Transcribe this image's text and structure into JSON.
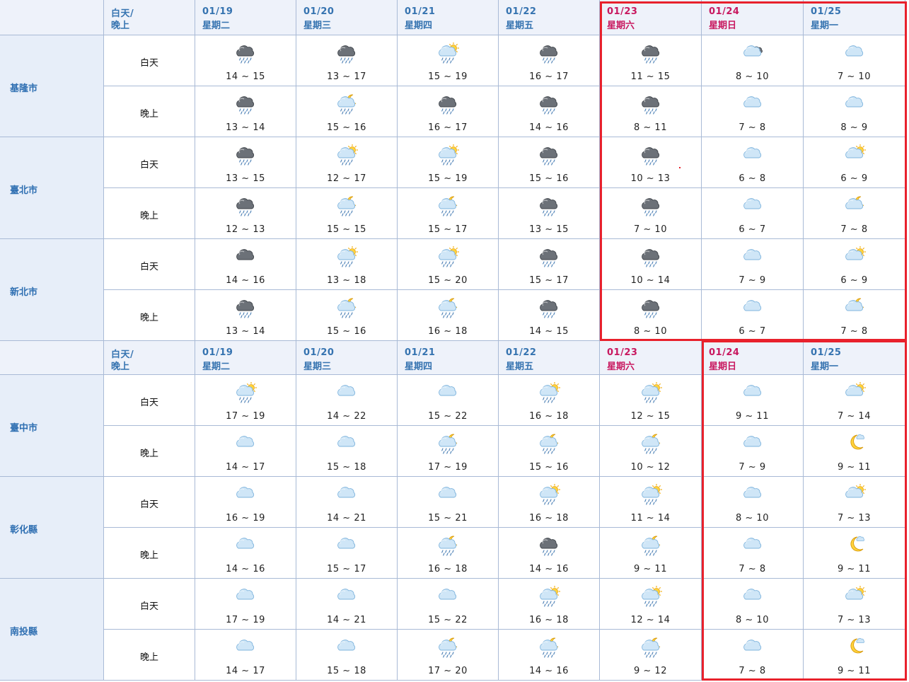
{
  "period_header": {
    "line1": "白天/",
    "line2": "晚上"
  },
  "days": [
    {
      "date": "01/19",
      "weekday": "星期二",
      "weekend": false
    },
    {
      "date": "01/20",
      "weekday": "星期三",
      "weekend": false
    },
    {
      "date": "01/21",
      "weekday": "星期四",
      "weekend": false
    },
    {
      "date": "01/22",
      "weekday": "星期五",
      "weekend": false
    },
    {
      "date": "01/23",
      "weekday": "星期六",
      "weekend": true
    },
    {
      "date": "01/24",
      "weekday": "星期日",
      "weekend": true
    },
    {
      "date": "01/25",
      "weekday": "星期一",
      "weekend": false
    }
  ],
  "period_labels": {
    "day": "白天",
    "night": "晚上"
  },
  "highlight_color": "#e8212c",
  "sections": [
    {
      "cities": [
        {
          "name": "基隆市",
          "day": [
            {
              "icon": "dark-cloud-rain-icon",
              "temp": "14 ~ 15"
            },
            {
              "icon": "dark-cloud-rain-icon",
              "temp": "13 ~ 17"
            },
            {
              "icon": "sun-cloud-rain-icon",
              "temp": "15 ~ 19"
            },
            {
              "icon": "dark-cloud-rain-icon",
              "temp": "16 ~ 17"
            },
            {
              "icon": "dark-cloud-rain-icon",
              "temp": "11 ~ 15"
            },
            {
              "icon": "cloud-dark-icon",
              "temp": "8 ~ 10"
            },
            {
              "icon": "cloud-icon",
              "temp": "7 ~ 10"
            }
          ],
          "night": [
            {
              "icon": "dark-cloud-rain-icon",
              "temp": "13 ~ 14"
            },
            {
              "icon": "moon-cloud-rain-icon",
              "temp": "15 ~ 16"
            },
            {
              "icon": "dark-cloud-rain-icon",
              "temp": "16 ~ 17"
            },
            {
              "icon": "dark-cloud-rain-icon",
              "temp": "14 ~ 16"
            },
            {
              "icon": "dark-cloud-rain-icon",
              "temp": "8 ~ 11"
            },
            {
              "icon": "cloud-icon",
              "temp": "7 ~ 8"
            },
            {
              "icon": "cloud-icon",
              "temp": "8 ~ 9"
            }
          ]
        },
        {
          "name": "臺北市",
          "day": [
            {
              "icon": "dark-cloud-rain-icon",
              "temp": "13 ~ 15"
            },
            {
              "icon": "sun-cloud-rain-icon",
              "temp": "12 ~ 17"
            },
            {
              "icon": "sun-cloud-rain-icon",
              "temp": "15 ~ 19"
            },
            {
              "icon": "dark-cloud-rain-icon",
              "temp": "15 ~ 16"
            },
            {
              "icon": "dark-cloud-rain-icon",
              "temp": "10 ~ 13"
            },
            {
              "icon": "cloud-icon",
              "temp": "6 ~ 8"
            },
            {
              "icon": "sun-cloud-icon",
              "temp": "6 ~ 9"
            }
          ],
          "night": [
            {
              "icon": "dark-cloud-rain-icon",
              "temp": "12 ~ 13"
            },
            {
              "icon": "moon-cloud-rain-icon",
              "temp": "15 ~ 15"
            },
            {
              "icon": "moon-cloud-rain-icon",
              "temp": "15 ~ 17"
            },
            {
              "icon": "dark-cloud-rain-icon",
              "temp": "13 ~ 15"
            },
            {
              "icon": "dark-cloud-rain-icon",
              "temp": "7 ~ 10"
            },
            {
              "icon": "cloud-icon",
              "temp": "6 ~ 7"
            },
            {
              "icon": "moon-cloud-icon",
              "temp": "7 ~ 8"
            }
          ]
        },
        {
          "name": "新北市",
          "day": [
            {
              "icon": "dark-cloud-icon",
              "temp": "14 ~ 16"
            },
            {
              "icon": "sun-cloud-rain-icon",
              "temp": "13 ~ 18"
            },
            {
              "icon": "sun-cloud-rain-icon",
              "temp": "15 ~ 20"
            },
            {
              "icon": "dark-cloud-rain-icon",
              "temp": "15 ~ 17"
            },
            {
              "icon": "dark-cloud-rain-icon",
              "temp": "10 ~ 14"
            },
            {
              "icon": "cloud-icon",
              "temp": "7 ~ 9"
            },
            {
              "icon": "sun-cloud-icon",
              "temp": "6 ~ 9"
            }
          ],
          "night": [
            {
              "icon": "dark-cloud-rain-icon",
              "temp": "13 ~ 14"
            },
            {
              "icon": "moon-cloud-rain-icon",
              "temp": "15 ~ 16"
            },
            {
              "icon": "moon-cloud-rain-icon",
              "temp": "16 ~ 18"
            },
            {
              "icon": "dark-cloud-rain-icon",
              "temp": "14 ~ 15"
            },
            {
              "icon": "dark-cloud-rain-icon",
              "temp": "8 ~ 10"
            },
            {
              "icon": "cloud-icon",
              "temp": "6 ~ 7"
            },
            {
              "icon": "moon-cloud-icon",
              "temp": "7 ~ 8"
            }
          ]
        }
      ]
    },
    {
      "cities": [
        {
          "name": "臺中市",
          "day": [
            {
              "icon": "sun-cloud-rain-icon",
              "temp": "17 ~ 19"
            },
            {
              "icon": "cloud-icon",
              "temp": "14 ~ 22"
            },
            {
              "icon": "cloud-icon",
              "temp": "15 ~ 22"
            },
            {
              "icon": "sun-cloud-rain-icon",
              "temp": "16 ~ 18"
            },
            {
              "icon": "sun-cloud-rain-icon",
              "temp": "12 ~ 15"
            },
            {
              "icon": "cloud-icon",
              "temp": "9 ~ 11"
            },
            {
              "icon": "sun-cloud-icon",
              "temp": "7 ~ 14"
            }
          ],
          "night": [
            {
              "icon": "cloud-icon",
              "temp": "14 ~ 17"
            },
            {
              "icon": "cloud-icon",
              "temp": "15 ~ 18"
            },
            {
              "icon": "moon-cloud-rain-icon",
              "temp": "17 ~ 19"
            },
            {
              "icon": "moon-cloud-rain-icon",
              "temp": "15 ~ 16"
            },
            {
              "icon": "moon-cloud-rain-icon",
              "temp": "10 ~ 12"
            },
            {
              "icon": "cloud-icon",
              "temp": "7 ~ 9"
            },
            {
              "icon": "moon-icon",
              "temp": "9 ~ 11"
            }
          ]
        },
        {
          "name": "彰化縣",
          "day": [
            {
              "icon": "cloud-icon",
              "temp": "16 ~ 19"
            },
            {
              "icon": "cloud-icon",
              "temp": "14 ~ 21"
            },
            {
              "icon": "cloud-icon",
              "temp": "15 ~ 21"
            },
            {
              "icon": "sun-cloud-rain-icon",
              "temp": "16 ~ 18"
            },
            {
              "icon": "sun-cloud-rain-icon",
              "temp": "11 ~ 14"
            },
            {
              "icon": "cloud-icon",
              "temp": "8 ~ 10"
            },
            {
              "icon": "sun-cloud-icon",
              "temp": "7 ~ 13"
            }
          ],
          "night": [
            {
              "icon": "cloud-icon",
              "temp": "14 ~ 16"
            },
            {
              "icon": "cloud-icon",
              "temp": "15 ~ 17"
            },
            {
              "icon": "moon-cloud-rain-icon",
              "temp": "16 ~ 18"
            },
            {
              "icon": "dark-cloud-rain-icon",
              "temp": "14 ~ 16"
            },
            {
              "icon": "moon-cloud-rain-icon",
              "temp": "9 ~ 11"
            },
            {
              "icon": "cloud-icon",
              "temp": "7 ~ 8"
            },
            {
              "icon": "moon-icon",
              "temp": "9 ~ 11"
            }
          ]
        },
        {
          "name": "南投縣",
          "day": [
            {
              "icon": "cloud-icon",
              "temp": "17 ~ 19"
            },
            {
              "icon": "cloud-icon",
              "temp": "14 ~ 21"
            },
            {
              "icon": "cloud-icon",
              "temp": "15 ~ 22"
            },
            {
              "icon": "sun-cloud-rain-icon",
              "temp": "16 ~ 18"
            },
            {
              "icon": "sun-cloud-rain-icon",
              "temp": "12 ~ 14"
            },
            {
              "icon": "cloud-icon",
              "temp": "8 ~ 10"
            },
            {
              "icon": "sun-cloud-icon",
              "temp": "7 ~ 13"
            }
          ],
          "night": [
            {
              "icon": "cloud-icon",
              "temp": "14 ~ 17"
            },
            {
              "icon": "cloud-icon",
              "temp": "15 ~ 18"
            },
            {
              "icon": "moon-cloud-rain-icon",
              "temp": "17 ~ 20"
            },
            {
              "icon": "moon-cloud-rain-icon",
              "temp": "14 ~ 16"
            },
            {
              "icon": "moon-cloud-rain-icon",
              "temp": "9 ~ 12"
            },
            {
              "icon": "cloud-icon",
              "temp": "7 ~ 8"
            },
            {
              "icon": "moon-icon",
              "temp": "9 ~ 11"
            }
          ]
        }
      ]
    }
  ]
}
